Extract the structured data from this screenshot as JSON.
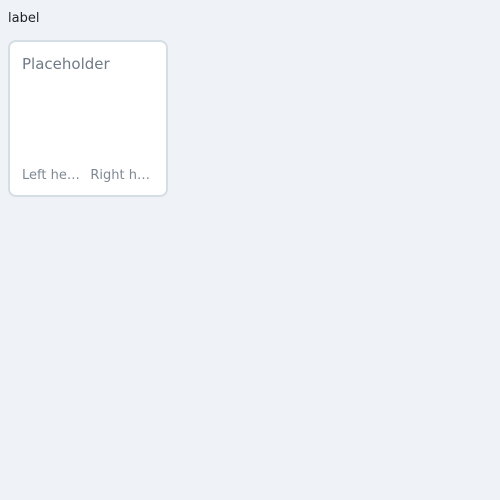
{
  "field": {
    "label": "label",
    "placeholder": "Placeholder",
    "helper_left": "Left he…",
    "helper_right": "Right h…"
  },
  "colors": {
    "background": "#eff3f7",
    "field_border": "#d5dde5",
    "placeholder_text": "#6f7b87",
    "helper_text": "#7f8994"
  }
}
